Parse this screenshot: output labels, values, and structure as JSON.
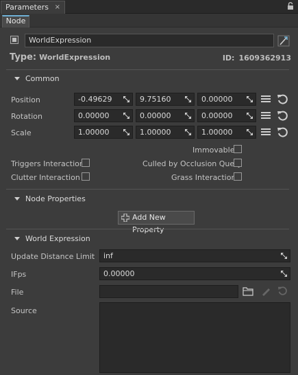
{
  "window": {
    "tab_label": "Parameters",
    "tab_close": "×",
    "subtab_label": "Node"
  },
  "node": {
    "name": "WorldExpression",
    "type_label": "Type:",
    "type_value": "WorldExpression",
    "id_label": "ID:",
    "id_value": "1609362913"
  },
  "common": {
    "title": "Common",
    "rows": [
      {
        "label": "Position",
        "values": [
          "-0.49629",
          "9.75160",
          "0.00000"
        ]
      },
      {
        "label": "Rotation",
        "values": [
          "0.00000",
          "0.00000",
          "0.00000"
        ]
      },
      {
        "label": "Scale",
        "values": [
          "1.00000",
          "1.00000",
          "1.00000"
        ]
      }
    ],
    "flags": {
      "immovable": "Immovable",
      "triggers_interaction": "Triggers Interaction",
      "culled_by_occlusion_query": "Culled by Occlusion Query",
      "clutter_interaction": "Clutter Interaction",
      "grass_interaction": "Grass Interaction"
    }
  },
  "node_properties": {
    "title": "Node Properties",
    "add_button": "Add New Property"
  },
  "world_expression": {
    "title": "World Expression",
    "update_distance_limit_label": "Update Distance Limit",
    "update_distance_limit_value": "inf",
    "ifps_label": "IFps",
    "ifps_value": "0.00000",
    "file_label": "File",
    "file_value": "",
    "source_label": "Source",
    "source_value": ""
  },
  "icons": {
    "close": "close-icon",
    "lock": "lock-icon",
    "pick": "pick-node-icon",
    "grip": "drag-grip-icon",
    "menu": "menu-icon",
    "reset": "reset-icon",
    "folder": "folder-icon",
    "edit": "edit-pencil-icon",
    "add": "plus-icon"
  },
  "colors": {
    "background": "#3c3c3c",
    "field": "#2a2a2a",
    "accent": "#6fb1d6"
  }
}
